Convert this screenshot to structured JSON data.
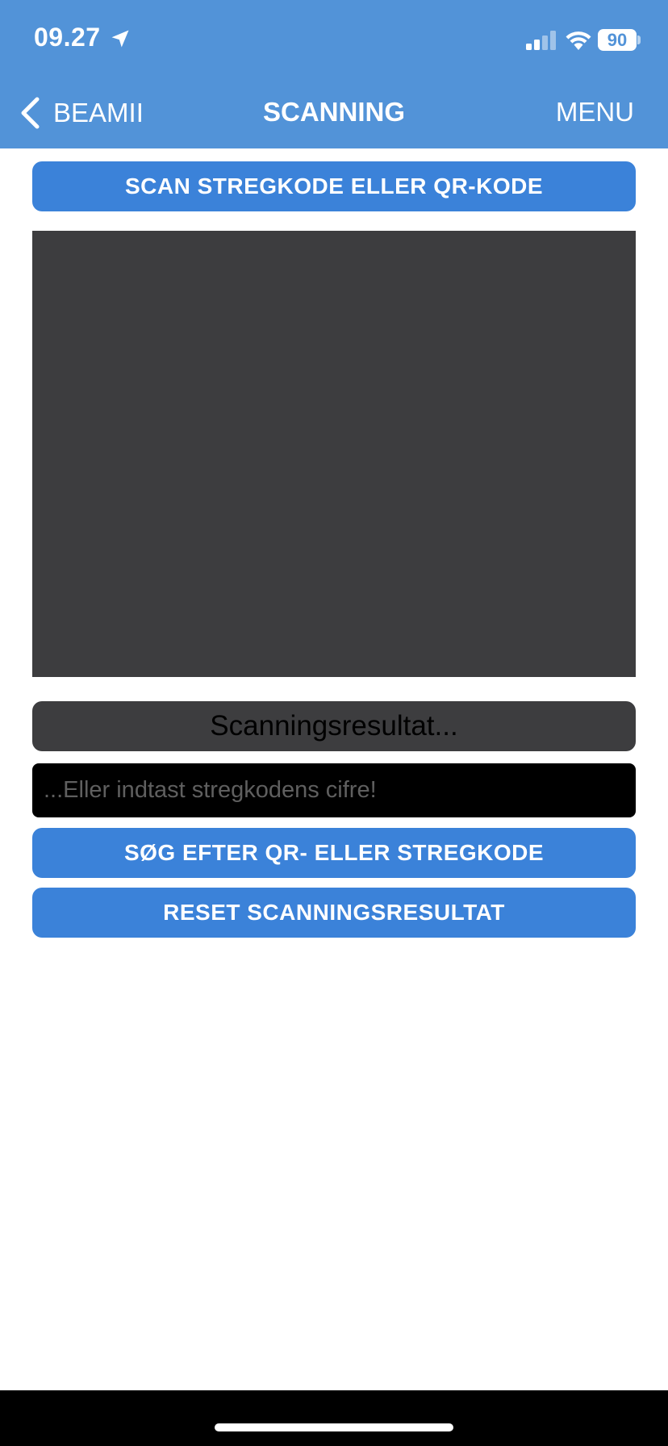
{
  "status_bar": {
    "time": "09.27",
    "battery": "90"
  },
  "nav": {
    "back_label": "BEAMII",
    "title": "SCANNING",
    "menu_label": "MENU"
  },
  "scanner": {
    "scan_button_label": "SCAN STREGKODE ELLER QR-KODE",
    "result_placeholder": "Scanningsresultat...",
    "input_placeholder": "...Eller indtast stregkodens cifre!",
    "input_value": "",
    "search_button_label": "SØG EFTER QR- ELLER STREGKODE",
    "reset_button_label": "RESET SCANNINGSRESULTAT"
  },
  "colors": {
    "header_bg": "#5293d8",
    "button_bg": "#3b82d9",
    "panel_bg": "#3d3d3f",
    "input_bg": "#000000"
  },
  "icons": {
    "location": "location-arrow-icon",
    "signal": "cellular-signal-icon",
    "wifi": "wifi-icon",
    "back": "chevron-left-icon"
  }
}
